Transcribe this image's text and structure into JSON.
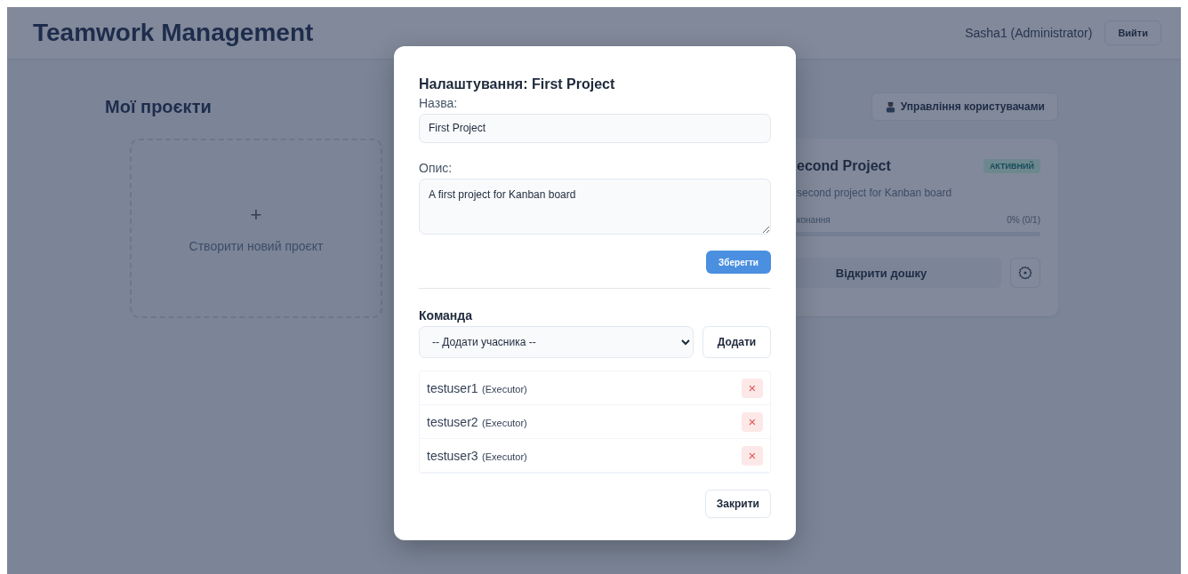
{
  "header": {
    "title": "Teamwork Management",
    "user": "Sasha1 (Administrator)",
    "logout": "Вийти"
  },
  "main": {
    "heading": "Мої проєкти",
    "manage_users": "Управління користувачами",
    "create_card": {
      "plus": "+",
      "label": "Створити новий проєкт"
    },
    "project_card": {
      "title": "econd Project",
      "status": "АКТИВНИЙ",
      "description": "second project for Kanban board",
      "progress_label": "конання",
      "progress_value": "0% (0/1)",
      "level": 0,
      "open_board": "Відкрити дошку"
    }
  },
  "modal": {
    "title": "Налаштування: First Project",
    "name_label": "Назва:",
    "name_value": "First Project",
    "description_label": "Опис:",
    "description_value": "A first project for Kanban board",
    "save": "Зберегти",
    "team_heading": "Команда",
    "member_select": "-- Додати учасника --",
    "add": "Додати",
    "members": [
      {
        "name": "testuser1",
        "role": "(Executor)",
        "remove": "×"
      },
      {
        "name": "testuser2",
        "role": "(Executor)",
        "remove": "×"
      },
      {
        "name": "testuser3",
        "role": "(Executor)",
        "remove": "×"
      }
    ],
    "close": "Закрити"
  }
}
